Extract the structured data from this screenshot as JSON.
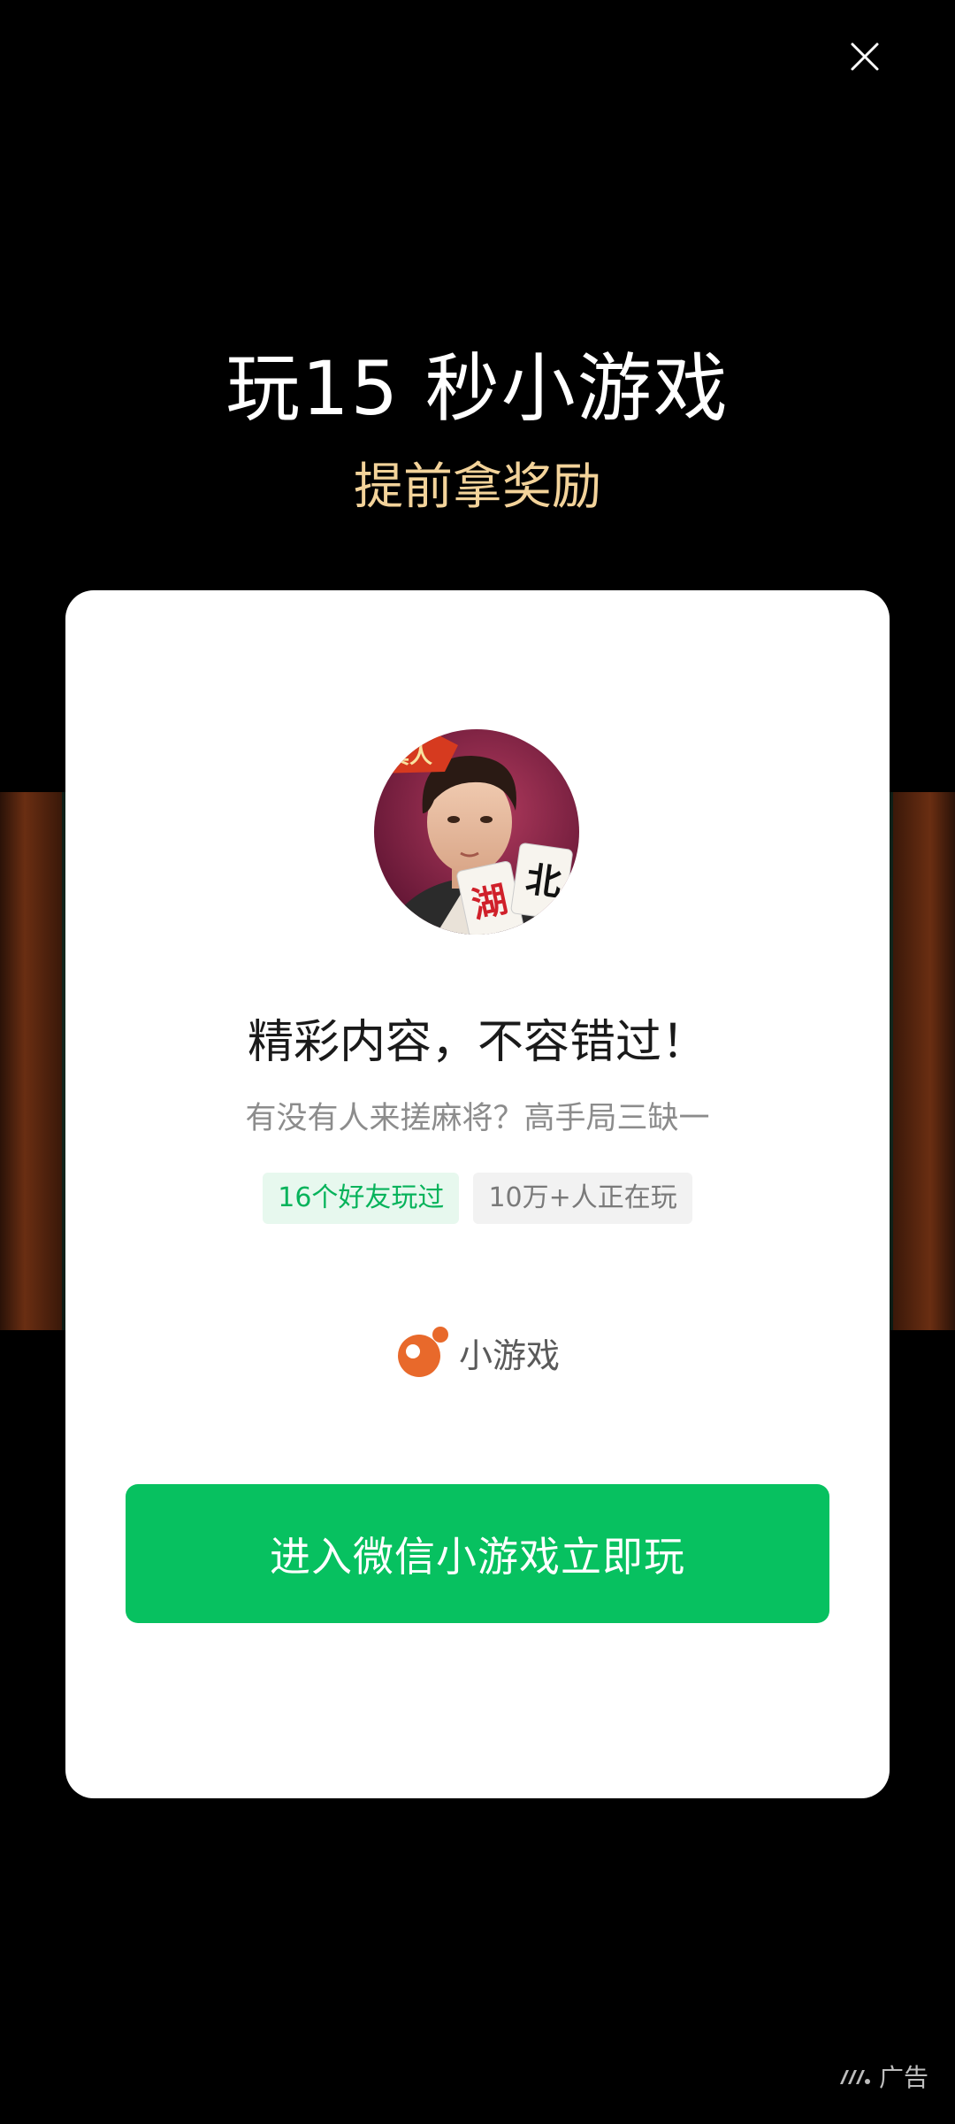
{
  "headline": "玩15 秒小游戏",
  "subheadline": "提前拿奖励",
  "card": {
    "title": "精彩内容，不容错过！",
    "description": "有没有人来搓麻将？高手局三缺一",
    "tags": [
      "16个好友玩过",
      "10万+人正在玩"
    ],
    "brand_label": "小游戏",
    "cta_label": "进入微信小游戏立即玩",
    "avatar_text": [
      "真人",
      "湖",
      "北"
    ]
  },
  "ad_label": "广告",
  "icons": {
    "close": "close-icon",
    "brand": "minigame-logo-icon",
    "ad": "ad-logo-icon"
  },
  "colors": {
    "accent_green": "#07c160",
    "subheadline_gold": "#f3d39a",
    "tag_green_text": "#07b35b",
    "brand_orange": "#e8692b"
  }
}
